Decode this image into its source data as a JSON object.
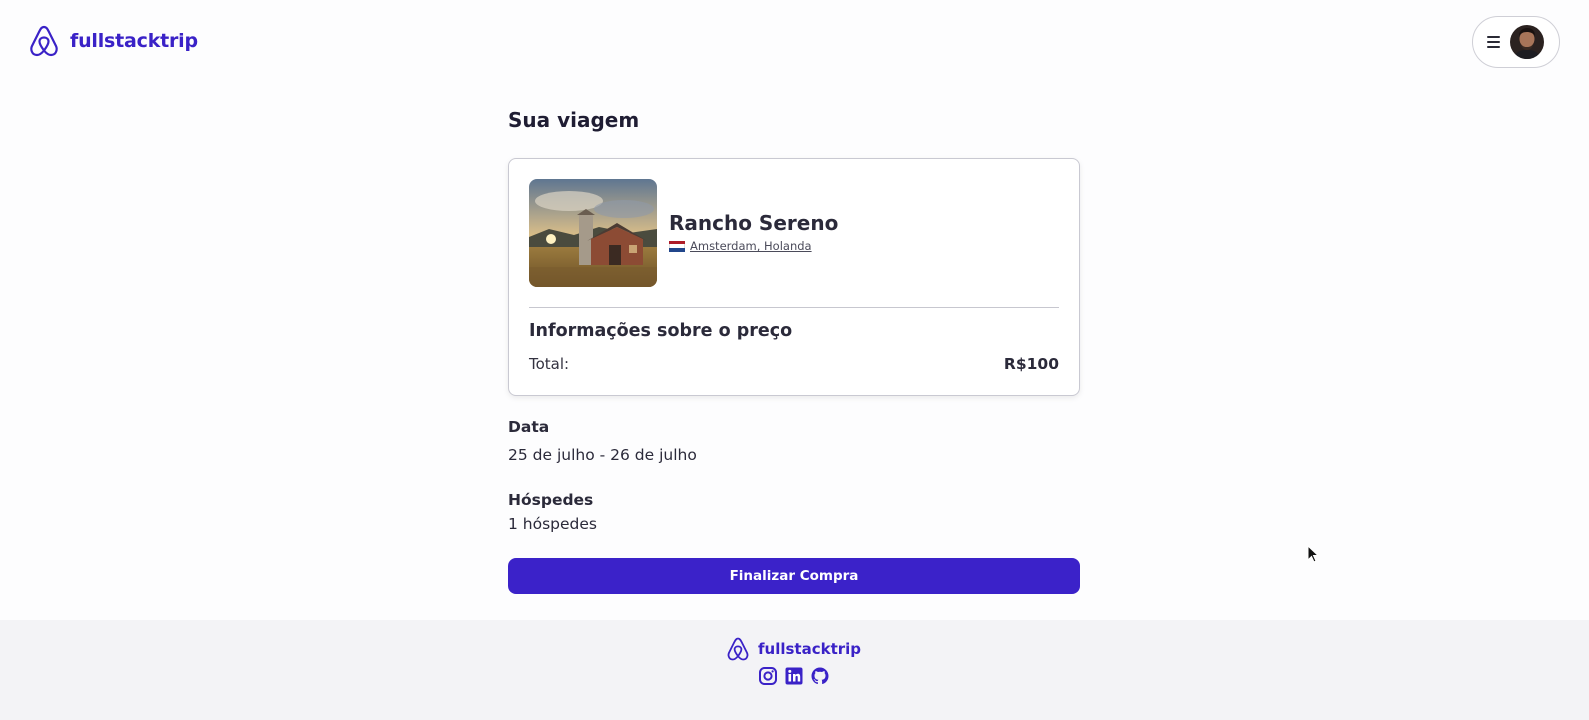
{
  "header": {
    "brand": "fullstacktrip",
    "menu_icon": "hamburger-icon",
    "avatar_icon": "user-avatar"
  },
  "main": {
    "title": "Sua viagem",
    "trip": {
      "name": "Rancho Sereno",
      "location": "Amsterdam, Holanda",
      "location_flag": "netherlands-flag-icon",
      "image_alt": "farm-house-image"
    },
    "price": {
      "title": "Informações sobre o preço",
      "total_label": "Total:",
      "total_value": "R$100"
    },
    "date": {
      "label": "Data",
      "value": "25 de julho - 26 de julho"
    },
    "guests": {
      "label": "Hóspedes",
      "value": "1 hóspedes"
    },
    "finish_button": "Finalizar Compra"
  },
  "footer": {
    "brand": "fullstacktrip",
    "socials": [
      "instagram-icon",
      "linkedin-icon",
      "github-icon"
    ]
  },
  "colors": {
    "brand": "#3a22c7",
    "button": "#3b22c9",
    "footer_bg": "#f3f3f6"
  }
}
